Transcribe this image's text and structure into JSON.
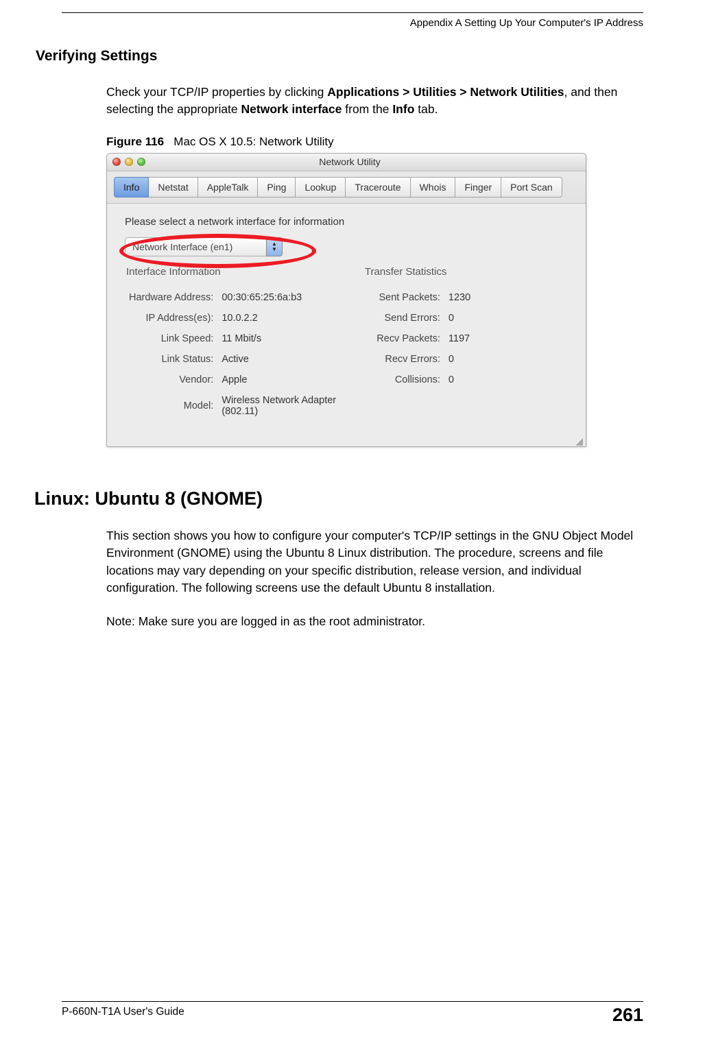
{
  "header": {
    "appendix_line": "Appendix A Setting Up Your Computer's IP Address"
  },
  "section": {
    "verifying_heading": "Verifying Settings",
    "p1_a": "Check your TCP/IP properties by clicking ",
    "p1_b_apps": "Applications > Utilities > Network Utilities",
    "p1_c": ", and then selecting the appropriate ",
    "p1_d_netif": "Network interface",
    "p1_e": " from the ",
    "p1_f_info": "Info",
    "p1_g": " tab.",
    "fig_label": "Figure 116",
    "fig_caption": "Mac OS X 10.5: Network Utility"
  },
  "netutil": {
    "title": "Network Utility",
    "tabs": [
      "Info",
      "Netstat",
      "AppleTalk",
      "Ping",
      "Lookup",
      "Traceroute",
      "Whois",
      "Finger",
      "Port Scan"
    ],
    "active_tab_index": 0,
    "prompt": "Please select a network interface for information",
    "interface_selected": "Network Interface (en1)",
    "left_heading": "Interface Information",
    "left_rows": [
      {
        "label": "Hardware Address:",
        "value": "00:30:65:25:6a:b3"
      },
      {
        "label": "IP Address(es):",
        "value": "10.0.2.2"
      },
      {
        "label": "Link Speed:",
        "value": "11 Mbit/s"
      },
      {
        "label": "Link Status:",
        "value": "Active"
      },
      {
        "label": "Vendor:",
        "value": "Apple"
      },
      {
        "label": "Model:",
        "value": "Wireless Network Adapter (802.11)"
      }
    ],
    "right_heading": "Transfer Statistics",
    "right_rows": [
      {
        "label": "Sent Packets:",
        "value": "1230"
      },
      {
        "label": "Send Errors:",
        "value": "0"
      },
      {
        "label": "Recv Packets:",
        "value": "1197"
      },
      {
        "label": "Recv Errors:",
        "value": "0"
      },
      {
        "label": "Collisions:",
        "value": "0"
      }
    ]
  },
  "linux": {
    "heading": "Linux: Ubuntu 8 (GNOME)",
    "para": "This section shows you how to configure your computer's TCP/IP settings in the GNU Object Model Environment (GNOME) using the Ubuntu 8 Linux distribution. The procedure, screens and file locations may vary depending on your specific distribution, release version, and individual configuration. The following screens use the default Ubuntu 8 installation.",
    "note": "Note: Make sure you are logged in as the root administrator."
  },
  "footer": {
    "guide": "P-660N-T1A User's Guide",
    "page": "261"
  }
}
